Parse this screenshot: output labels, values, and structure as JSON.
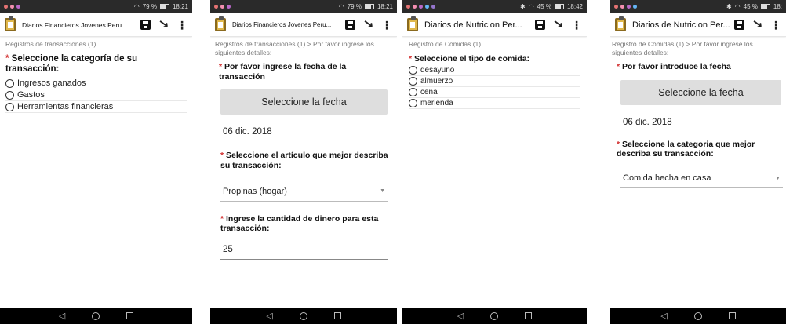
{
  "colors": {
    "required_star": "#d32f2f",
    "date_button_bg": "#dedede",
    "navbar_bg": "#000000"
  },
  "icons": {
    "app": "clipboard-icon",
    "save": "save-icon",
    "export": "arrow-down-right-icon",
    "menu": "more-vertical-icon"
  },
  "screens": [
    {
      "status": {
        "battery": "79 %",
        "time": "18:21"
      },
      "app_title": "Diarios Financieros Jovenes Peru...",
      "breadcrumb": "Registros de transacciones (1)",
      "question": "Seleccione la categoría de su transacción:",
      "options": [
        "Ingresos ganados",
        "Gastos",
        "Herramientas financieras"
      ]
    },
    {
      "status": {
        "battery": "79 %",
        "time": "18:21"
      },
      "app_title": "Diarios Financieros Jovenes Peru...",
      "breadcrumb": "Registros de transacciones (1) > Por favor ingrese los siguientes detalles:",
      "date_question": "Por favor ingrese la fecha de la transacción",
      "date_button": "Seleccione la fecha",
      "date_value": "06 dic. 2018",
      "item_question": "Seleccione el artículo que mejor describa su transacción:",
      "item_value": "Propinas (hogar)",
      "amount_question": "Ingrese la cantidad de dinero para esta transacción:",
      "amount_value": "25"
    },
    {
      "status": {
        "battery": "45 %",
        "time": "18:42"
      },
      "app_title": "Diarios de Nutricion Per...",
      "breadcrumb": "Registro de Comidas (1)",
      "question": "Seleccione el tipo de comida:",
      "options": [
        "desayuno",
        "almuerzo",
        "cena",
        "merienda"
      ]
    },
    {
      "status": {
        "battery": "45 %",
        "time": "18:"
      },
      "app_title": "Diarios de Nutricion Per...",
      "breadcrumb": "Registro de Comidas (1) > Por favor ingrese los siguientes detalles:",
      "date_question": "Por favor introduce la fecha",
      "date_button": "Seleccione la fecha",
      "date_value": "06 dic. 2018",
      "item_question": "Seleccione la categoria que mejor describa su transacción:",
      "item_value": "Comida hecha en casa"
    }
  ]
}
